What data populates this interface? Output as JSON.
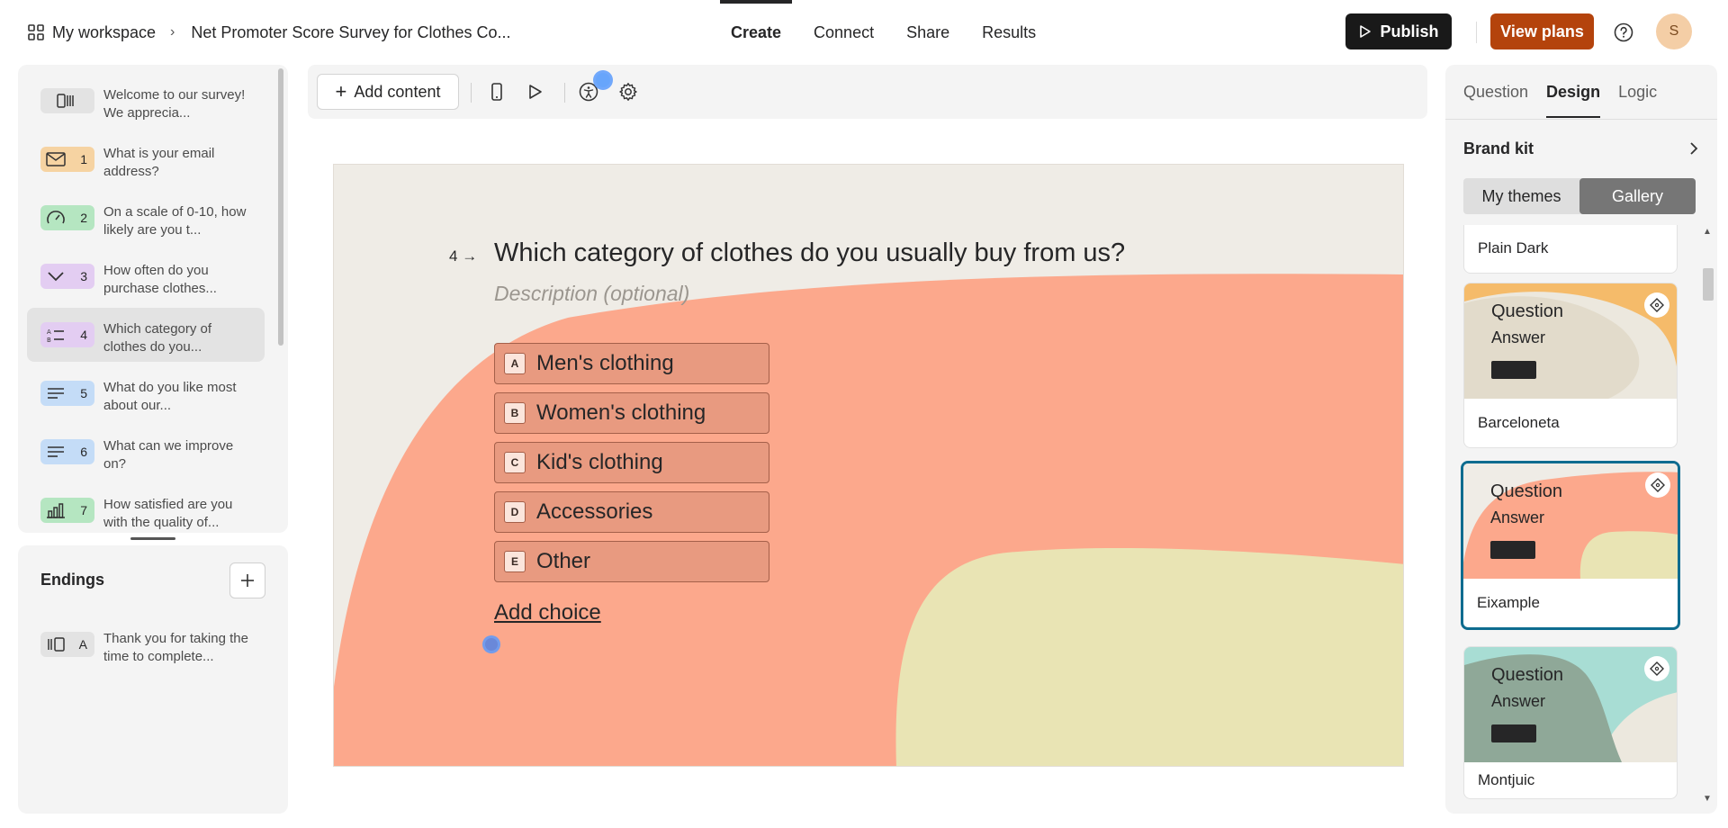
{
  "header": {
    "workspace_label": "My workspace",
    "form_title": "Net Promoter Score Survey for Clothes Co...",
    "tabs": [
      {
        "label": "Create",
        "active": true
      },
      {
        "label": "Connect",
        "active": false
      },
      {
        "label": "Share",
        "active": false
      },
      {
        "label": "Results",
        "active": false
      }
    ],
    "publish_label": "Publish",
    "view_plans_label": "View plans",
    "avatar_initial": "S",
    "publish_color": "#191919",
    "plans_color": "#b4430c"
  },
  "sidebar": {
    "items": [
      {
        "badge": "",
        "text": "Welcome to our survey! We apprecia...",
        "color": "#e3e3e3",
        "icon": "welcome-screen-icon"
      },
      {
        "badge": "1",
        "text": "What is your email address?",
        "color": "#f6d3a2",
        "icon": "mail-icon"
      },
      {
        "badge": "2",
        "text": "On a scale of 0-10, how likely are you t...",
        "color": "#b5e6c1",
        "icon": "gauge-icon"
      },
      {
        "badge": "3",
        "text": "How often do you purchase clothes...",
        "color": "#e3cdf2",
        "icon": "chevron-down-icon"
      },
      {
        "badge": "4",
        "text": "Which category of clothes do you...",
        "color": "#e3cdf2",
        "icon": "multiple-choice-icon"
      },
      {
        "badge": "5",
        "text": "What do you like most about our...",
        "color": "#c4dcf7",
        "icon": "text-lines-icon"
      },
      {
        "badge": "6",
        "text": "What can we improve on?",
        "color": "#c4dcf7",
        "icon": "text-lines-icon"
      },
      {
        "badge": "7",
        "text": "How satisfied are you with the quality of...",
        "color": "#b5e6c1",
        "icon": "bar-chart-icon"
      }
    ],
    "endings_title": "Endings",
    "ending": {
      "badge": "A",
      "text": "Thank you for taking the time to complete..."
    }
  },
  "toolbar": {
    "add_content_label": "Add content"
  },
  "question": {
    "number": "4",
    "title": "Which category of clothes do you usually buy from us?",
    "description_placeholder": "Description (optional)",
    "choices": [
      {
        "key": "A",
        "label": "Men's clothing"
      },
      {
        "key": "B",
        "label": "Women's clothing"
      },
      {
        "key": "C",
        "label": "Kid's clothing"
      },
      {
        "key": "D",
        "label": "Accessories"
      },
      {
        "key": "E",
        "label": "Other"
      }
    ],
    "add_choice_label": "Add choice",
    "colors": {
      "background": "#efece6",
      "coral": "#fca88c",
      "yellow": "#e9e4b4"
    }
  },
  "design_panel": {
    "tabs": [
      {
        "label": "Question",
        "active": false
      },
      {
        "label": "Design",
        "active": true
      },
      {
        "label": "Logic",
        "active": false
      }
    ],
    "brand_kit_label": "Brand kit",
    "segments": [
      {
        "label": "My themes",
        "active": false
      },
      {
        "label": "Gallery",
        "active": true
      }
    ],
    "themes": [
      {
        "name": "Plain Dark"
      },
      {
        "name": "Barceloneta",
        "question": "Question",
        "answer": "Answer"
      },
      {
        "name": "Eixample",
        "question": "Question",
        "answer": "Answer",
        "selected": true
      },
      {
        "name": "Montjuic",
        "question": "Question",
        "answer": "Answer"
      }
    ]
  }
}
